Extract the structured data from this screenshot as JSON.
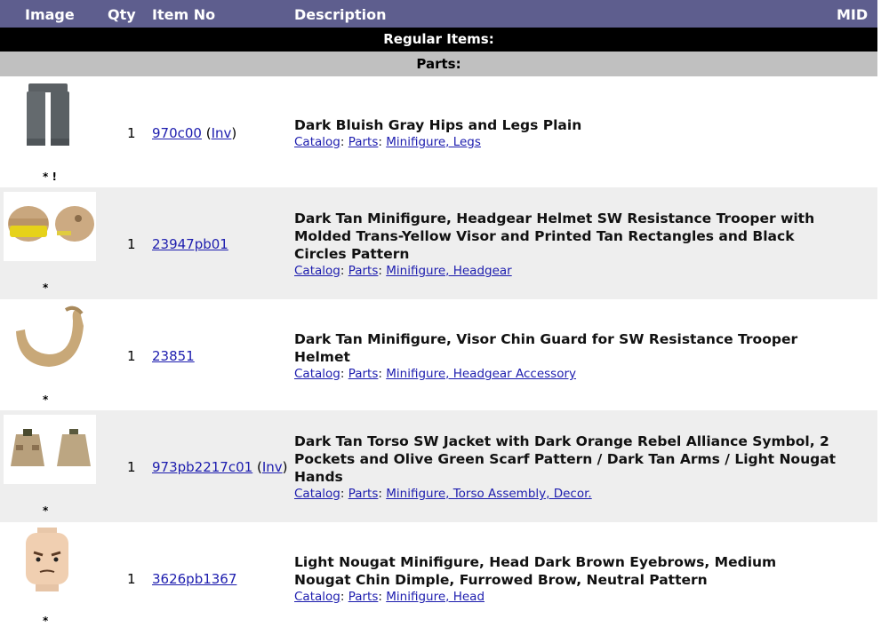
{
  "header": {
    "image": "Image",
    "qty": "Qty",
    "item_no": "Item No",
    "description": "Description",
    "mid": "MID"
  },
  "section": "Regular Items:",
  "subsection": "Parts:",
  "colors": {
    "header_bg": "#5e5e8e",
    "link": "#1c1cae"
  },
  "rows": [
    {
      "mark": "* !",
      "qty": "1",
      "item_no": "970c00",
      "inv": "Inv",
      "title": "Dark Bluish Gray Hips and Legs Plain",
      "catalog": "Catalog",
      "parts": "Parts",
      "category": "Minifigure, Legs"
    },
    {
      "mark": "*",
      "qty": "1",
      "item_no": "23947pb01",
      "title": "Dark Tan Minifigure, Headgear Helmet SW Resistance Trooper with Molded Trans-Yellow Visor and Printed Tan Rectangles and Black Circles Pattern",
      "catalog": "Catalog",
      "parts": "Parts",
      "category": "Minifigure, Headgear"
    },
    {
      "mark": "*",
      "qty": "1",
      "item_no": "23851",
      "title": "Dark Tan Minifigure, Visor Chin Guard for SW Resistance Trooper Helmet",
      "catalog": "Catalog",
      "parts": "Parts",
      "category": "Minifigure, Headgear Accessory"
    },
    {
      "mark": "*",
      "qty": "1",
      "item_no": "973pb2217c01",
      "inv": "Inv",
      "title": "Dark Tan Torso SW Jacket with Dark Orange Rebel Alliance Symbol, 2 Pockets and Olive Green Scarf Pattern / Dark Tan Arms / Light Nougat Hands",
      "catalog": "Catalog",
      "parts": "Parts",
      "category": "Minifigure, Torso Assembly, Decor."
    },
    {
      "mark": "*",
      "qty": "1",
      "item_no": "3626pb1367",
      "title": "Light Nougat Minifigure, Head Dark Brown Eyebrows, Medium Nougat Chin Dimple, Furrowed Brow, Neutral Pattern",
      "catalog": "Catalog",
      "parts": "Parts",
      "category": "Minifigure, Head"
    }
  ]
}
